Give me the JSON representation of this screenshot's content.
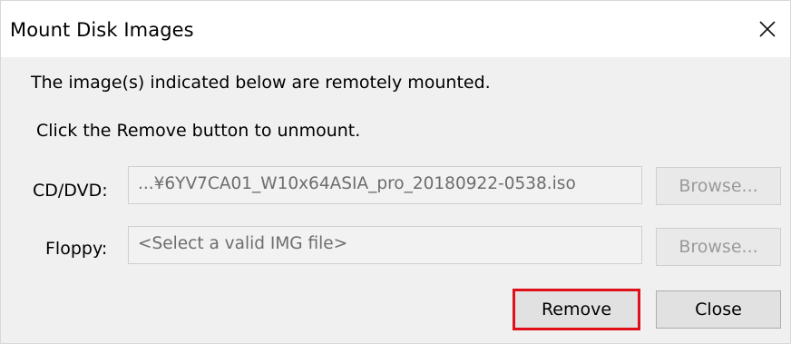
{
  "window": {
    "title": "Mount Disk Images",
    "close_icon": "close-icon"
  },
  "message": {
    "line1": "The image(s) indicated below are remotely mounted.",
    "line2": "Click the Remove button to unmount."
  },
  "cd_dvd": {
    "label": "CD/DVD:",
    "value": "...¥6YV7CA01_W10x64ASIA_pro_20180922-0538.iso",
    "browse_label": "Browse..."
  },
  "floppy": {
    "label": "Floppy:",
    "value": "<Select a valid IMG file>",
    "browse_label": "Browse..."
  },
  "actions": {
    "remove_label": "Remove",
    "close_label": "Close"
  },
  "colors": {
    "highlight_border": "#e0101a",
    "dialog_bg": "#f0f0f0",
    "title_bg": "#ffffff"
  }
}
